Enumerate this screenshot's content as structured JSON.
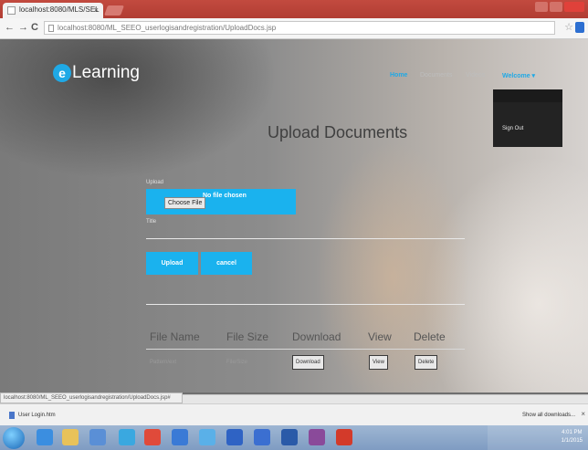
{
  "browser": {
    "tab_title": "localhost:8080/MLS/SEL",
    "tab_close": "×",
    "back": "←",
    "forward": "→",
    "reload": "C",
    "url": "localhost:8080/ML_SEEO_userlogisandregistration/UploadDocs.jsp",
    "star": "☆"
  },
  "site": {
    "logo_letter": "e",
    "logo_text": "Learning",
    "nav": {
      "home": "Home",
      "item2": "Documents",
      "item3": "Videos",
      "user": "Welcome ▾"
    },
    "dropdown": {
      "signout": "Sign Out"
    }
  },
  "upload": {
    "title": "Upload Documents",
    "file_label": "Upload",
    "choose_file": "Choose File",
    "no_file": "No file chosen",
    "desc_label": "Title",
    "upload_button": "Upload",
    "cancel_button": "cancel"
  },
  "table": {
    "headers": [
      "File Name",
      "File Size",
      "Download",
      "View",
      "Delete"
    ],
    "row": {
      "file_name": "Pattern/ext",
      "file_size": "File/Size",
      "download": "Download",
      "view": "View",
      "delete": "Delete"
    }
  },
  "status_url": "localhost:8080/ML_SEEO_userlogisandregistration/UploadDocs.jsp#",
  "downloads": {
    "item": "User Login.htm",
    "show_all": "Show all downloads...",
    "close": "×"
  },
  "taskbar": {
    "time": "4:01 PM",
    "date": "1/1/2015"
  },
  "colors": {
    "accent": "#1ab2ee",
    "chrome_tabbar": "#c24a3f",
    "dropdown_bg": "#232323"
  }
}
